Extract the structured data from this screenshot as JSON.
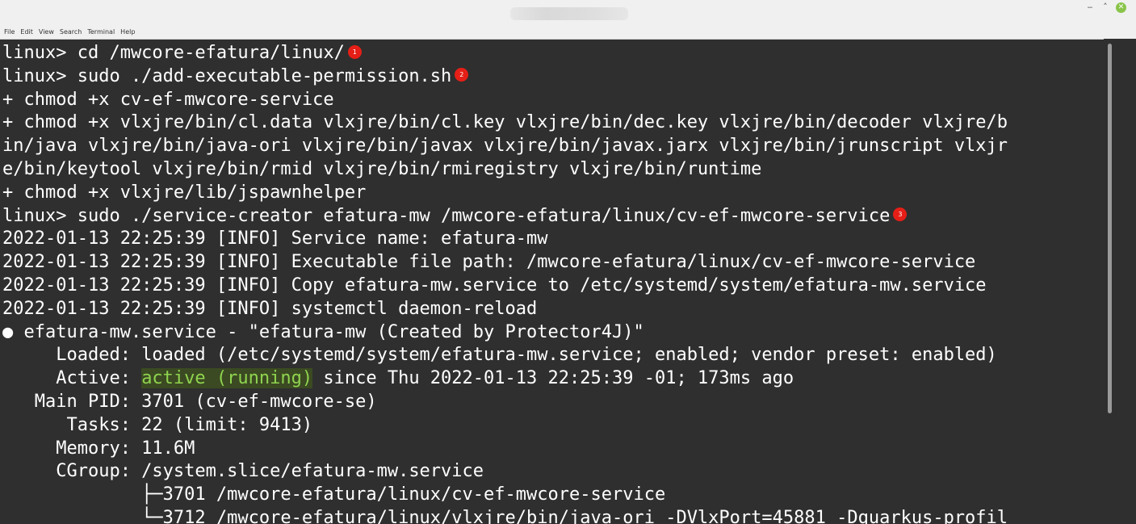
{
  "window": {
    "controls": {
      "minimize": "‒",
      "maximize": "˄",
      "close": "✕"
    },
    "colors": {
      "background": "#2f2f2f",
      "text": "#ffffff",
      "highlight_bg": "#3b4a22",
      "highlight_fg": "#8fd34f",
      "badge": "#e51f17"
    }
  },
  "menubar": {
    "items": [
      "File",
      "Edit",
      "View",
      "Search",
      "Terminal",
      "Help"
    ]
  },
  "terminal": {
    "lines": [
      {
        "text": "linux> cd /mwcore-efatura/linux/",
        "badge": "1"
      },
      {
        "text": "linux> sudo ./add-executable-permission.sh",
        "badge": "2"
      },
      {
        "text": "+ chmod +x cv-ef-mwcore-service"
      },
      {
        "text": "+ chmod +x vlxjre/bin/cl.data vlxjre/bin/cl.key vlxjre/bin/dec.key vlxjre/bin/decoder vlxjre/b"
      },
      {
        "text": "in/java vlxjre/bin/java-ori vlxjre/bin/javax vlxjre/bin/javax.jarx vlxjre/bin/jrunscript vlxjr"
      },
      {
        "text": "e/bin/keytool vlxjre/bin/rmid vlxjre/bin/rmiregistry vlxjre/bin/runtime"
      },
      {
        "text": "+ chmod +x vlxjre/lib/jspawnhelper"
      },
      {
        "text": "linux> sudo ./service-creator efatura-mw /mwcore-efatura/linux/cv-ef-mwcore-service",
        "badge": "3"
      },
      {
        "text": "2022-01-13 22:25:39 [INFO] Service name: efatura-mw"
      },
      {
        "text": "2022-01-13 22:25:39 [INFO] Executable file path: /mwcore-efatura/linux/cv-ef-mwcore-service"
      },
      {
        "text": "2022-01-13 22:25:39 [INFO] Copy efatura-mw.service to /etc/systemd/system/efatura-mw.service"
      },
      {
        "text": "2022-01-13 22:25:39 [INFO] systemctl daemon-reload"
      },
      {
        "text": "● efatura-mw.service - \"efatura-mw (Created by Protector4J)\""
      },
      {
        "text": "     Loaded: loaded (/etc/systemd/system/efatura-mw.service; enabled; vendor preset: enabled)"
      },
      {
        "pre": "     Active: ",
        "highlight": "active (running)",
        "post": " since Thu 2022-01-13 22:25:39 -01; 173ms ago"
      },
      {
        "text": "   Main PID: 3701 (cv-ef-mwcore-se)"
      },
      {
        "text": "      Tasks: 22 (limit: 9413)"
      },
      {
        "text": "     Memory: 11.6M"
      },
      {
        "text": "     CGroup: /system.slice/efatura-mw.service"
      },
      {
        "text": "             ├─3701 /mwcore-efatura/linux/cv-ef-mwcore-service"
      },
      {
        "text": "             └─3712 /mwcore-efatura/linux/vlxjre/bin/java-ori -DVlxPort=45881 -Dquarkus-profil"
      }
    ]
  }
}
